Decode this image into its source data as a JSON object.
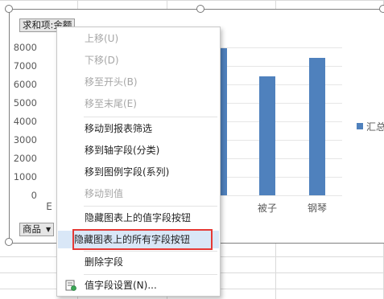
{
  "chart": {
    "value_field_button": "求和项:金额",
    "category_field_button": "商品",
    "legend_label": "汇总",
    "accent_color": "#4f81bd",
    "y_ticks": [
      "8000",
      "7000",
      "6000",
      "5000",
      "4000",
      "3000",
      "2000",
      "1000",
      "0"
    ],
    "x_labels": [
      "E",
      "被子",
      "钢琴"
    ]
  },
  "chart_data": {
    "type": "bar",
    "categories": [
      "E",
      "被子",
      "钢琴"
    ],
    "series": [
      {
        "name": "汇总",
        "values": [
          null,
          6450,
          7450
        ]
      }
    ],
    "ylim": [
      0,
      8500
    ],
    "grid": true,
    "legend": "right"
  },
  "menu": {
    "move_up": "上移(U)",
    "move_down": "下移(D)",
    "move_to_start": "移至开头(B)",
    "move_to_end": "移至末尾(E)",
    "move_to_report_filter": "移动到报表筛选",
    "move_to_axis_field": "移到轴字段(分类)",
    "move_to_legend_field": "移到图例字段(系列)",
    "move_to_values": "移动到值",
    "hide_value_field_buttons": "隐藏图表上的值字段按钮",
    "hide_all_field_buttons": "隐藏图表上的所有字段按钮",
    "remove_field": "删除字段",
    "value_field_settings": "值字段设置(N)...",
    "highlight_color": "#e53935"
  }
}
